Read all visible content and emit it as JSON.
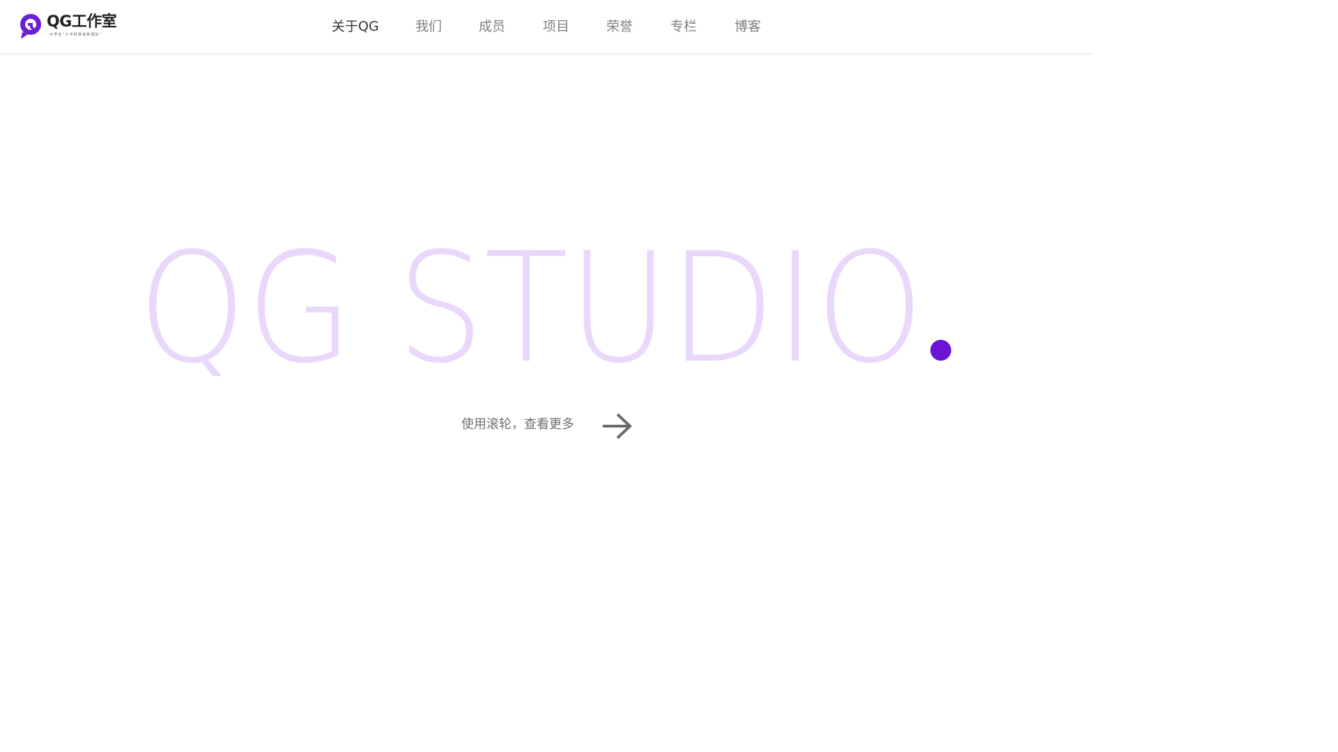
{
  "header": {
    "logo": {
      "title": "QG工作室",
      "slogan": "大学生“小平科技创新团队”",
      "mark_color": "#6a1fd1"
    },
    "nav": [
      {
        "label": "关于QG",
        "active": true
      },
      {
        "label": "我们",
        "active": false
      },
      {
        "label": "成员",
        "active": false
      },
      {
        "label": "项目",
        "active": false
      },
      {
        "label": "荣誉",
        "active": false
      },
      {
        "label": "专栏",
        "active": false
      },
      {
        "label": "博客",
        "active": false
      }
    ]
  },
  "hero": {
    "headline": "QG STUDIO",
    "headline_color": "#e9d8fb",
    "dot_color": "#6a14d6"
  },
  "scroll_hint": {
    "text": "使用滚轮，查看更多",
    "icon": "arrow-right-icon"
  }
}
